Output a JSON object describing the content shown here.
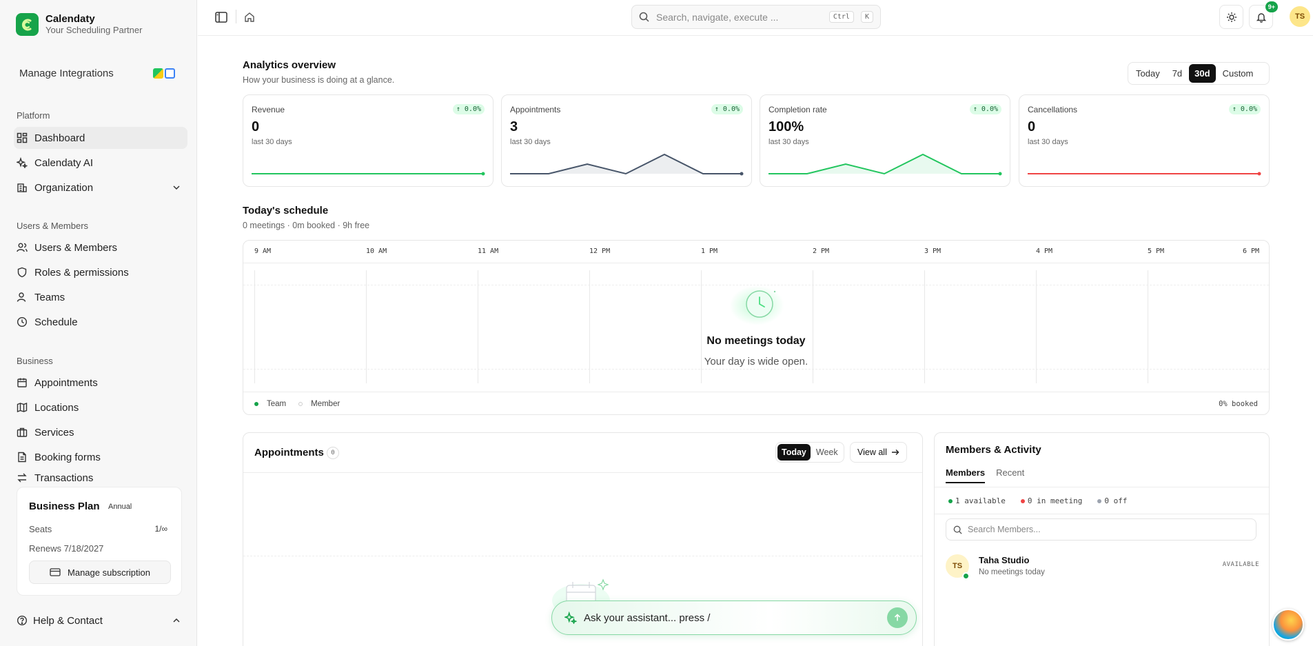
{
  "brand": {
    "name": "Calendaty",
    "tagline": "Your Scheduling Partner"
  },
  "sidebar": {
    "integrations_label": "Manage Integrations",
    "sections": [
      {
        "title": "Platform",
        "items": [
          {
            "label": "Dashboard",
            "icon": "dashboard-icon",
            "active": true
          },
          {
            "label": "Calendaty AI",
            "icon": "sparkles-icon"
          },
          {
            "label": "Organization",
            "icon": "building-icon",
            "expandable": true
          }
        ]
      },
      {
        "title": "Users & Members",
        "items": [
          {
            "label": "Users & Members",
            "icon": "users-icon"
          },
          {
            "label": "Roles & permissions",
            "icon": "shield-icon"
          },
          {
            "label": "Teams",
            "icon": "team-icon"
          },
          {
            "label": "Schedule",
            "icon": "clock-icon"
          }
        ]
      },
      {
        "title": "Business",
        "items": [
          {
            "label": "Appointments",
            "icon": "calendar-icon"
          },
          {
            "label": "Locations",
            "icon": "map-icon"
          },
          {
            "label": "Services",
            "icon": "briefcase-icon"
          },
          {
            "label": "Booking forms",
            "icon": "file-icon"
          },
          {
            "label": "Transactions",
            "icon": "transactions-icon"
          }
        ]
      }
    ],
    "plan": {
      "title": "Business Plan",
      "badge": "Annual",
      "seats_label": "Seats",
      "seats_value": "1/∞",
      "renews": "Renews 7/18/2027",
      "manage_label": "Manage subscription"
    },
    "help_label": "Help & Contact"
  },
  "topbar": {
    "search_placeholder": "Search, navigate, execute ...",
    "shortcut_ctrl": "Ctrl",
    "shortcut_key": "K",
    "notifications_badge": "9+",
    "user_initials": "TS"
  },
  "analytics": {
    "title": "Analytics overview",
    "subtitle": "How your business is doing at a glance.",
    "ranges": [
      "Today",
      "7d",
      "30d",
      "Custom"
    ],
    "selected_range": "30d",
    "metrics": [
      {
        "label": "Revenue",
        "value": "0",
        "sub": "last 30 days",
        "delta": "↑ 0.0%",
        "color": "#22c55e",
        "spark": [
          0,
          0,
          0,
          0,
          0,
          0,
          0
        ]
      },
      {
        "label": "Appointments",
        "value": "3",
        "sub": "last 30 days",
        "delta": "↑ 0.0%",
        "color": "#475569",
        "spark": [
          0,
          0,
          1,
          0,
          2,
          0,
          0
        ]
      },
      {
        "label": "Completion rate",
        "value": "100%",
        "sub": "last 30 days",
        "delta": "↑ 0.0%",
        "color": "#22c55e",
        "spark": [
          0,
          0,
          1,
          0,
          2,
          0,
          0
        ]
      },
      {
        "label": "Cancellations",
        "value": "0",
        "sub": "last 30 days",
        "delta": "↑ 0.0%",
        "color": "#ef4444",
        "spark": [
          0,
          0,
          0,
          0,
          0,
          0,
          0
        ]
      }
    ]
  },
  "schedule": {
    "title": "Today's schedule",
    "subtitle": "0 meetings · 0m booked · 9h free",
    "hours": [
      "9 AM",
      "10 AM",
      "11 AM",
      "12 PM",
      "1 PM",
      "2 PM",
      "3 PM",
      "4 PM",
      "5 PM",
      "6 PM"
    ],
    "empty_title": "No meetings today",
    "empty_sub": "Your day is wide open.",
    "legend_team": "Team",
    "legend_member": "Member",
    "booked": "0% booked"
  },
  "appointments": {
    "title": "Appointments",
    "count": "0",
    "tabs": [
      "Today",
      "Week"
    ],
    "selected_tab": "Today",
    "view_all": "View all"
  },
  "members": {
    "title": "Members & Activity",
    "tabs": [
      "Members",
      "Recent"
    ],
    "selected_tab": "Members",
    "stats": [
      {
        "label": "1 available",
        "color": "#16a34a"
      },
      {
        "label": "0 in meeting",
        "color": "#ef4444"
      },
      {
        "label": "0 off",
        "color": "#9ca3af"
      }
    ],
    "search_placeholder": "Search Members...",
    "list": [
      {
        "initials": "TS",
        "name": "Taha Studio",
        "sub": "No meetings today",
        "status": "AVAILABLE"
      }
    ]
  },
  "assistant": {
    "placeholder": "Ask your assistant... press /"
  },
  "colors": {
    "accent": "#16a34a",
    "brand": "#16a34a"
  }
}
